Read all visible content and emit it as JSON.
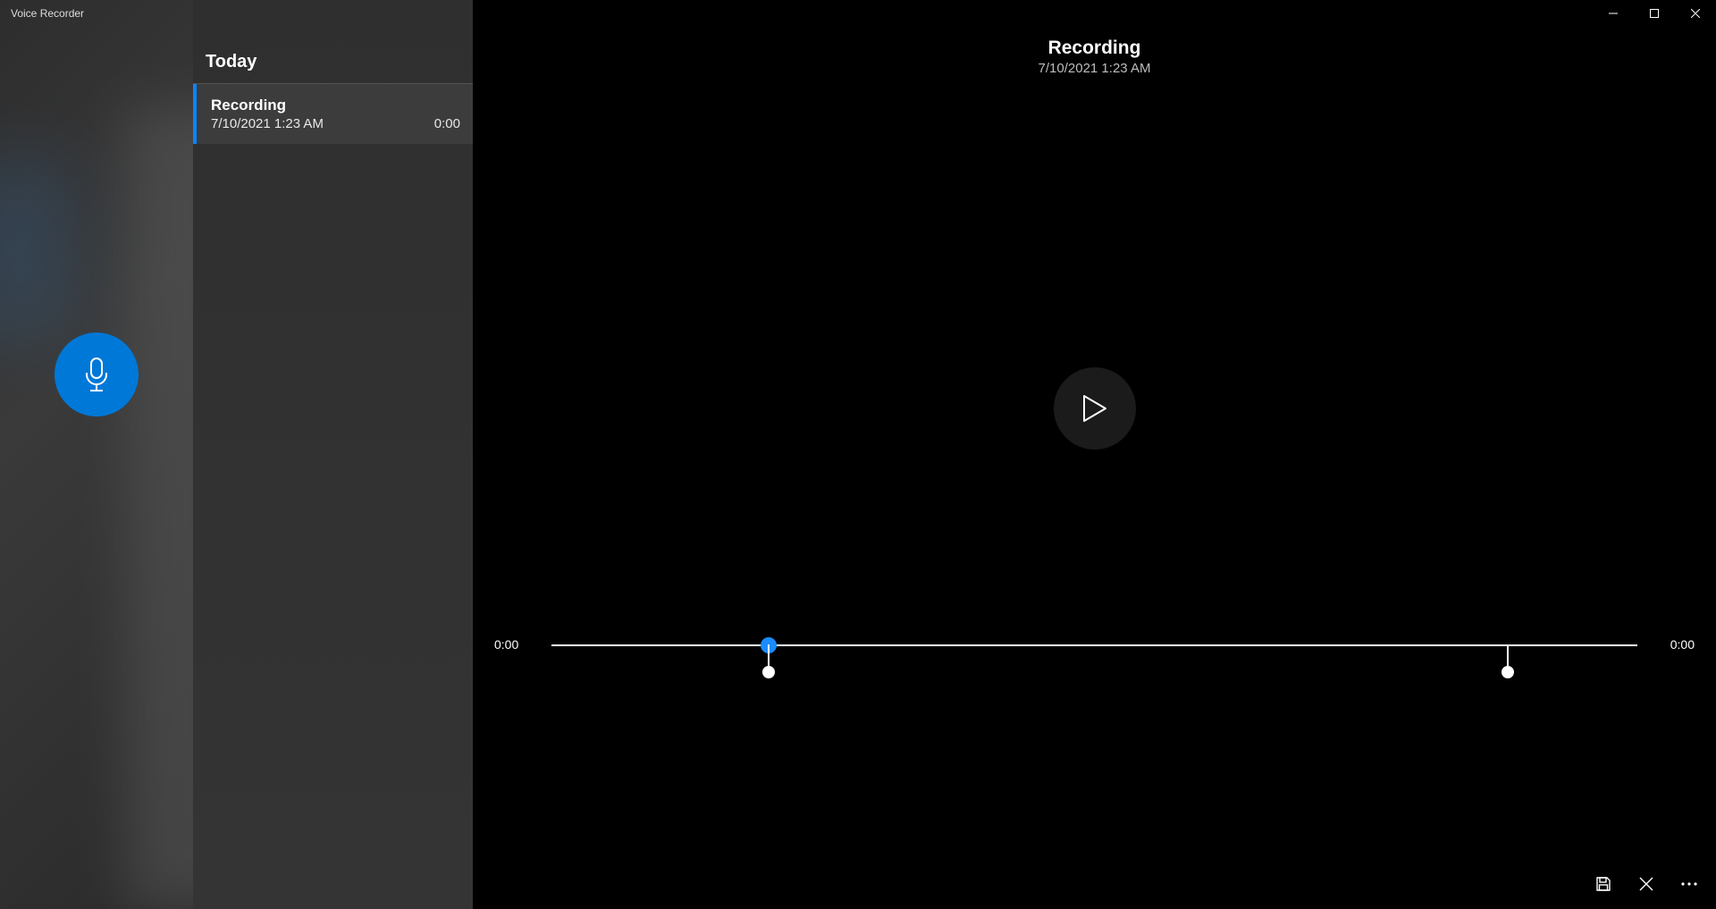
{
  "window": {
    "title": "Voice Recorder"
  },
  "sidebar": {
    "section_label": "Today",
    "items": [
      {
        "title": "Recording",
        "datetime": "7/10/2021 1:23 AM",
        "duration": "0:00"
      }
    ]
  },
  "player": {
    "title": "Recording",
    "datetime": "7/10/2021 1:23 AM",
    "time_left": "0:00",
    "time_right": "0:00"
  },
  "colors": {
    "accent": "#0078D7",
    "thumb": "#1a8cff"
  }
}
